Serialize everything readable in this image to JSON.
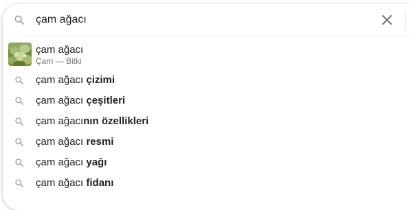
{
  "search": {
    "query": "çam ağacı",
    "search_icon": "search-icon",
    "clear_icon": "close-icon"
  },
  "entity": {
    "title": "çam ağacı",
    "subtitle": "Çam — Bitki",
    "thumbnail": "pine-tree-thumbnail"
  },
  "suggestions": [
    {
      "prefix": "çam ağacı ",
      "completion": "çizimi"
    },
    {
      "prefix": "çam ağacı ",
      "completion": "çeşitleri"
    },
    {
      "prefix": "çam ağacı",
      "completion": "nın özellikleri"
    },
    {
      "prefix": "çam ağacı ",
      "completion": "resmi"
    },
    {
      "prefix": "çam ağacı ",
      "completion": "yağı"
    },
    {
      "prefix": "çam ağacı ",
      "completion": "fidanı"
    }
  ],
  "colors": {
    "text": "#202124",
    "subtext": "#70757a",
    "icon": "#9aa0a6",
    "divider": "#e8eaed"
  }
}
